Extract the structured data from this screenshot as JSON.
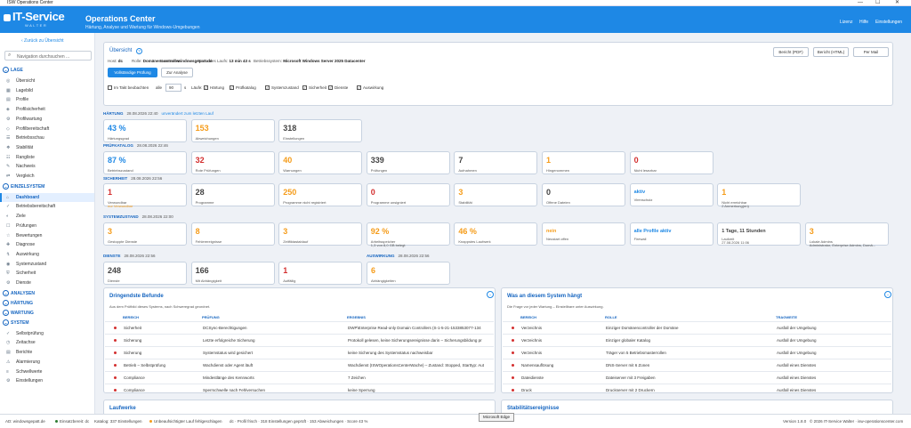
{
  "window": {
    "title": "ISW Operations Center",
    "controls": [
      "—",
      "☐",
      "✕"
    ]
  },
  "header": {
    "logo_main": "IT-Service",
    "logo_sub": "WALTER",
    "title": "Operations Center",
    "subtitle": "Härtung, Analyse und Wartung für Windows-Umgebungen",
    "nav": [
      "Lizenz",
      "Hilfe",
      "Einstellungen"
    ]
  },
  "sidebar": {
    "back": "‹ Zurück zu Übersicht",
    "search_placeholder": "Navigation durchsuchen ...",
    "sections": [
      {
        "title": "LAGE",
        "items": [
          "Übersicht",
          "Lagebild",
          "Profile",
          "Profilsicherheit",
          "Profilwartung",
          "Profilbereitschaft",
          "Betriebsschau",
          "Stabilität",
          "Rangliste",
          "Nachweis",
          "Vergleich"
        ]
      },
      {
        "title": "EINZELSYSTEM",
        "items": [
          "Dashboard",
          "Betriebsbereitschaft",
          "Ziele",
          "Prüfungen",
          "Bewertungen",
          "Diagnose",
          "Auswirkung",
          "Systemzustand",
          "Sicherheit",
          "Dienste"
        ]
      },
      {
        "title": "ANALYSEN",
        "items": []
      },
      {
        "title": "HÄRTUNG",
        "items": []
      },
      {
        "title": "WARTUNG",
        "items": []
      },
      {
        "title": "SYSTEM",
        "items": [
          "Selbstprüfung",
          "Zeitachse",
          "Berichte",
          "Alarmierung",
          "Schwellwerte",
          "Einstellungen"
        ]
      }
    ]
  },
  "overview": {
    "title": "Übersicht",
    "meta": [
      {
        "k": "Host:",
        "v": "dc"
      },
      {
        "k": "Rolle:",
        "v": "Domänencontroller"
      },
      {
        "k": "Domäne:",
        "v": "windowsgepatt.de"
      },
      {
        "k": "Dauer des Laufs:",
        "v": "13 min 43 s"
      },
      {
        "k": "Betriebssystem:",
        "v": "Microsoft Windows Server 2025 Datacenter"
      }
    ],
    "buttons": {
      "full": "Vollständige Prüfung",
      "analysis": "Zur Analyse",
      "pdf": "Bericht (PDF)",
      "html": "Bericht (HTML)",
      "mail": "Per Mail"
    },
    "options": {
      "watch": "Im Takt beobachten",
      "every": "alle",
      "interval": "90",
      "unit": "s",
      "runs": "Läufe:",
      "checks": [
        "Härtung",
        "Prüfkatalog",
        "Systemzustand",
        "Sicherheit",
        "Dienste",
        "Auswirkung"
      ]
    }
  },
  "groups": [
    {
      "title": "HÄRTUNG",
      "ts": "28.08.2026 22:40",
      "link": "unverändert zum letzten Lauf",
      "tiles": [
        {
          "v": "43 %",
          "l": "Härtungsgrad",
          "c": "blue"
        },
        {
          "v": "153",
          "l": "Abweichungen",
          "c": "orange"
        },
        {
          "v": "318",
          "l": "Einstellungen",
          "c": "gray"
        }
      ]
    },
    {
      "title": "PRÜFKATALOG",
      "ts": "28.08.2026 22:46",
      "tiles": [
        {
          "v": "87 %",
          "l": "Betriebszustand",
          "c": "blue"
        },
        {
          "v": "32",
          "l": "Rote Prüfungen",
          "c": "red"
        },
        {
          "v": "40",
          "l": "Warnungen",
          "c": "orange"
        },
        {
          "v": "339",
          "l": "Prüfungen",
          "c": "gray"
        },
        {
          "v": "7",
          "l": "Aufnahmen",
          "c": "gray"
        },
        {
          "v": "1",
          "l": "Hingenommen",
          "c": "orange"
        },
        {
          "v": "0",
          "l": "Nicht lesezbar",
          "c": "red"
        }
      ]
    },
    {
      "title": "SICHERHEIT",
      "ts": "28.08.2026 22:56",
      "tiles": [
        {
          "v": "1",
          "l": "Verwundbar",
          "l2": "nur Verwundbar",
          "c": "red"
        },
        {
          "v": "28",
          "l": "Programme",
          "c": "gray"
        },
        {
          "v": "250",
          "l": "Programme nicht registriert",
          "c": "orange"
        },
        {
          "v": "0",
          "l": "Programme unsigniert",
          "c": "red"
        },
        {
          "v": "3",
          "l": "Stabilität",
          "c": "orange"
        },
        {
          "v": "0",
          "l": "Offene Dateien",
          "c": "gray"
        },
        {
          "v": "aktiv",
          "l": "Virenschutz",
          "c": "blue",
          "small": true
        },
        {
          "v": "1",
          "l": "Nicht erreichbar",
          "l2": "2 Anmerkung(en)",
          "c": "orange"
        }
      ]
    },
    {
      "title": "SYSTEMZUSTAND",
      "ts": "28.08.2026 22:00",
      "tiles": [
        {
          "v": "3",
          "l": "Gestoppte Dienste",
          "c": "orange"
        },
        {
          "v": "8",
          "l": "Fehlerereignisse",
          "c": "orange"
        },
        {
          "v": "3",
          "l": "Zeitfiktastablauf",
          "c": "orange"
        },
        {
          "v": "92 %",
          "l": "Arbeitsspeicher",
          "l2": "1,3 von 8,0 GB belegt",
          "c": "orange"
        },
        {
          "v": "46 %",
          "l": "Knappstes Laufwerk",
          "c": "orange"
        },
        {
          "v": "nein",
          "l": "Neustart offen",
          "c": "orange",
          "small": true
        },
        {
          "v": "alle Profile aktiv",
          "l": "Firewall",
          "c": "blue",
          "small": true
        },
        {
          "v": "1 Tage, 11 Stunden",
          "l": "Laufzeit",
          "l2": "27.08.2026 11:06",
          "c": "gray",
          "small": true
        },
        {
          "v": "3",
          "l": "Lokale Admins",
          "l2": "Administrator, Enterprise Admins, Domä...",
          "c": "orange"
        }
      ]
    },
    {
      "title": "DIENSTE",
      "ts": "28.08.2026 22:56",
      "tiles": [
        {
          "v": "248",
          "l": "Dienste",
          "c": "gray"
        },
        {
          "v": "166",
          "l": "Mit Abhängigkeit",
          "c": "gray"
        },
        {
          "v": "1",
          "l": "Auffällig",
          "c": "red"
        }
      ]
    },
    {
      "title": "AUSWIRKUNG",
      "ts": "28.08.2026 22:56",
      "tiles": [
        {
          "v": "6",
          "l": "Abhängigkeiten",
          "c": "orange"
        }
      ]
    }
  ],
  "findings": {
    "title": "Dringendste Befunde",
    "subtitle": "Aus dem Prüfbild dieses Systems, nach Schweregrad geordnet.",
    "headers": [
      "BEREICH",
      "PRÜFUNG",
      "ERGEBNIS"
    ],
    "rows": [
      [
        "Sicherheit",
        "DCSync-Berechtigungen",
        "DWP\\Enterprise Read-only Domain Controllers (S-1-5-21-1533853077-134"
      ],
      [
        "Sicherung",
        "Letzte erfolgreiche Sicherung",
        "Protokoll gelesen, keine Sicherungsereignisse darin – Sicherungsbildung pr"
      ],
      [
        "Sicherung",
        "Systemstatus wird gesichert",
        "keine Sicherung des Systemstatus nachweisbar"
      ],
      [
        "Betrieb – Selbstprüfung",
        "Wachdienst oder Agent läuft",
        "Wachdienst (ISWOperationsCenterWache) – Zustand: Stopped, Starttyp: Aut"
      ],
      [
        "Compliance",
        "Mindestlänge des Kennworts",
        "7 Zeichen"
      ],
      [
        "Compliance",
        "Sperrschwelle nach Fehlversuchen",
        "keine Sperrung"
      ]
    ]
  },
  "depends": {
    "title": "Was an diesem System hängt",
    "subtitle": "Die Frage vor jeder Wartung – Einstellbare unter Auswirkung.",
    "headers": [
      "BEREICH",
      "ROLLE",
      "TRAGWEITE"
    ],
    "rows": [
      [
        "Verzeichnis",
        "Einziger Domänencontroller der Domäne",
        "Ausfall der Umgebung"
      ],
      [
        "Verzeichnis",
        "Einziger globaler Katalog",
        "Ausfall der Umgebung"
      ],
      [
        "Verzeichnis",
        "Träger von 5 Betriebsmasterrollen",
        "Ausfall der Umgebung"
      ],
      [
        "Namensauflösung",
        "DNS-Server mit 6 Zonen",
        "Ausfall eines Dienstes"
      ],
      [
        "Dateidienste",
        "Dateiserver mit 3 Freigaben",
        "Ausfall eines Dienstes"
      ],
      [
        "Druck",
        "Druckserver mit 2 Druckern",
        "Ausfall eines Dienstes"
      ]
    ]
  },
  "bottom": {
    "left": "Laufwerke",
    "right": "Stabilitätsereignisse"
  },
  "status": {
    "ad": "AD: windowsgepatt.de",
    "state": "Einsatzbereit: dc",
    "catalog": "Katalog: 337 Einstellungen",
    "warn": "Unbeaufsichtigter Lauf fehlgeschlagen",
    "profile": "dc · Profil frisch · 318 Einstellungen geprüft · 153 Abweichungen · Score 43 %",
    "version": "Version 1.8.0",
    "copy": "© 2026 IT-Service Walter · isw-operationscenter.com"
  },
  "tooltip": "Microsoft Edge",
  "colors": {
    "accent": "#1e88e5",
    "red": "#d32f2f",
    "orange": "#f59c1a",
    "green": "#2e7d32"
  }
}
